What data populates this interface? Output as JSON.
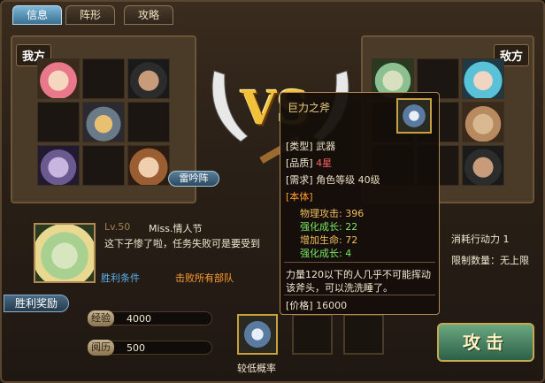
{
  "tabs": [
    {
      "label": "信息",
      "active": true
    },
    {
      "label": "阵形",
      "active": false
    },
    {
      "label": "攻略",
      "active": false
    }
  ],
  "left_side": {
    "label": "我方",
    "formation_button": "雷吟阵"
  },
  "right_side": {
    "label": "敌方"
  },
  "vs_text": "VS",
  "tooltip": {
    "title": "巨力之斧",
    "type_key": "[类型]",
    "type_val": "武器",
    "quality_key": "[品质]",
    "quality_val": "4星",
    "require_key": "[需求]",
    "require_val": "角色等级  40级",
    "base_key": "[本体]",
    "stats": [
      {
        "text": "物理攻击: 396",
        "color": "y"
      },
      {
        "text": "强化成长: 22",
        "color": "g"
      },
      {
        "text": "增加生命: 72",
        "color": "y"
      },
      {
        "text": "强化成长: 4",
        "color": "g"
      }
    ],
    "description": "力量120以下的人几乎不可能挥动该斧头，可以洗洗睡了。",
    "price_key": "[价格]",
    "price_val": "16000"
  },
  "enemy": {
    "level": "Lv.50",
    "name": "Miss.情人节",
    "dialogue": "这下子惨了啦，任务失败可是要受到",
    "win_condition_label": "胜利条件",
    "win_condition_value": "击败所有部队"
  },
  "cost_label": "消耗行动力  1",
  "limit_label": "限制数量：无上限",
  "rewards": {
    "tag": "胜利奖励",
    "exp_label": "经验",
    "exp_value": "4000",
    "xp_label": "阅历",
    "xp_value": "500",
    "item_caption": "较低概率"
  },
  "attack_button": "攻击"
}
